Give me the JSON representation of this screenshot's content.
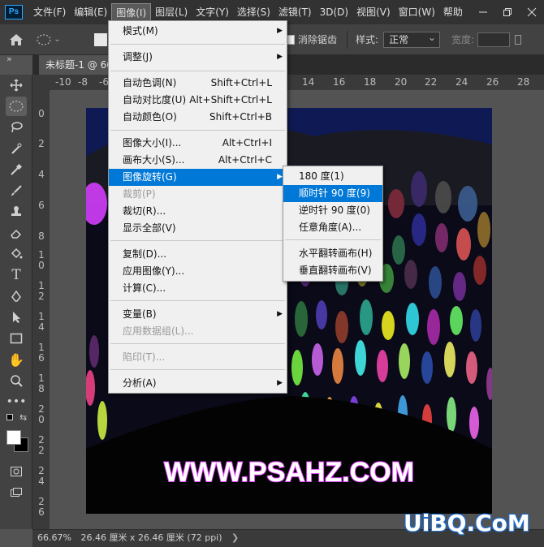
{
  "app": {
    "logo": "Ps"
  },
  "menubar": {
    "items": [
      "文件(F)",
      "编辑(E)",
      "图像(I)",
      "图层(L)",
      "文字(Y)",
      "选择(S)",
      "滤镜(T)",
      "3D(D)",
      "视图(V)",
      "窗口(W)",
      "帮助"
    ],
    "active_index": 2,
    "window_buttons": [
      "minimize-icon",
      "restore-icon",
      "close-icon"
    ]
  },
  "options": {
    "antialias_label": "消除锯齿",
    "style_label": "样式:",
    "style_value": "正常",
    "width_label": "宽度:"
  },
  "tab": {
    "title": "未标题-1 @ 66"
  },
  "rulers": {
    "top": [
      "-10",
      "-8",
      "-6",
      "14",
      "16",
      "18",
      "20",
      "22",
      "24",
      "26",
      "28"
    ],
    "left": [
      "0",
      "2",
      "4",
      "6",
      "8",
      "1\n0",
      "1\n2",
      "1\n4",
      "1\n6",
      "1\n8",
      "2\n0",
      "2\n2",
      "2\n4",
      "2\n6"
    ]
  },
  "image_menu": {
    "items": [
      {
        "label": "模式(M)",
        "submenu": true
      },
      {
        "label": "调整(J)",
        "submenu": true
      },
      {
        "label": "自动色调(N)",
        "shortcut": "Shift+Ctrl+L"
      },
      {
        "label": "自动对比度(U)",
        "shortcut": "Alt+Shift+Ctrl+L"
      },
      {
        "label": "自动颜色(O)",
        "shortcut": "Shift+Ctrl+B"
      },
      {
        "label": "图像大小(I)...",
        "shortcut": "Alt+Ctrl+I"
      },
      {
        "label": "画布大小(S)...",
        "shortcut": "Alt+Ctrl+C"
      },
      {
        "label": "图像旋转(G)",
        "submenu": true,
        "highlighted": true
      },
      {
        "label": "裁剪(P)",
        "disabled": true
      },
      {
        "label": "裁切(R)..."
      },
      {
        "label": "显示全部(V)"
      },
      {
        "label": "复制(D)..."
      },
      {
        "label": "应用图像(Y)..."
      },
      {
        "label": "计算(C)..."
      },
      {
        "label": "变量(B)",
        "submenu": true
      },
      {
        "label": "应用数据组(L)...",
        "disabled": true
      },
      {
        "label": "陷印(T)...",
        "disabled": true
      },
      {
        "label": "分析(A)",
        "submenu": true
      }
    ]
  },
  "rotate_submenu": {
    "items": [
      {
        "label": "180 度(1)"
      },
      {
        "label": "顺时针 90 度(9)",
        "highlighted": true
      },
      {
        "label": "逆时针 90 度(0)"
      },
      {
        "label": "任意角度(A)..."
      },
      {
        "label": "水平翻转画布(H)"
      },
      {
        "label": "垂直翻转画布(V)"
      }
    ]
  },
  "canvas": {
    "text": "WWW.PSAHZ.COM"
  },
  "status": {
    "zoom": "66.67%",
    "doc_info": "26.46 厘米 x 26.46 厘米 (72 ppi)",
    "arrow": "❯"
  },
  "watermark": {
    "text": "UiBQ.CoM"
  },
  "colors": {
    "accent": "#0078d7",
    "canvas_text": "#ffffff",
    "canvas_text_outline": "#e040fb"
  }
}
